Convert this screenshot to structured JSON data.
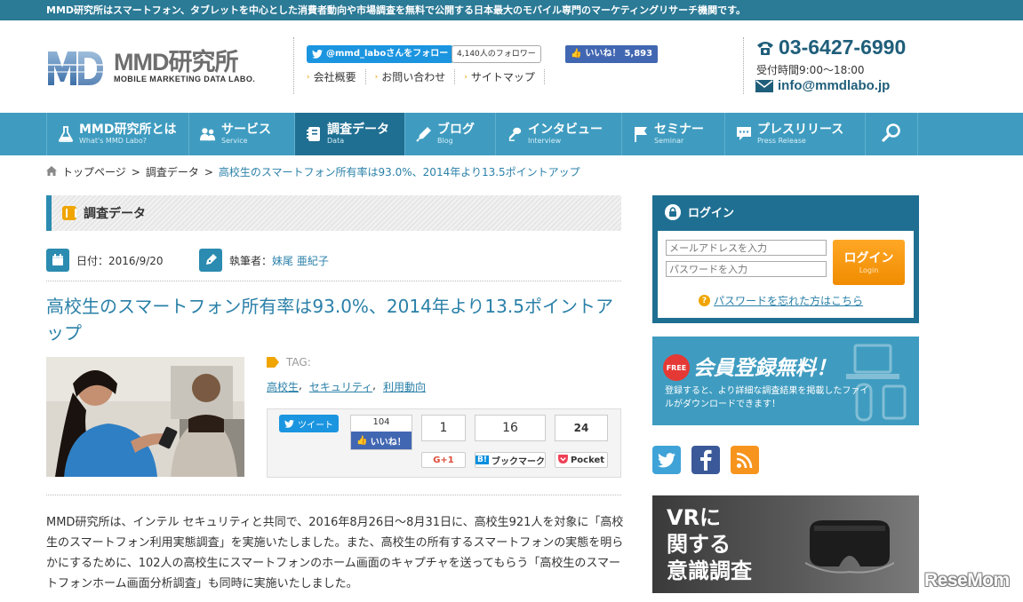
{
  "topbar": {
    "text": "MMD研究所はスマートフォン、タブレットを中心とした消費者動向や市場調査を無料で公開する日本最大のモバイル専門のマーケティングリサーチ機関です。"
  },
  "logo": {
    "title": "MMD研究所",
    "subtitle": "MOBILE MARKETING DATA LABO."
  },
  "social_header": {
    "twitter_follow": "@mmd_laboさんをフォロー",
    "follower_count": "4,140人のフォロワー",
    "fb_like": "いいね！",
    "fb_count": "5,893"
  },
  "header_links": [
    "会社概要",
    "お問い合わせ",
    "サイトマップ"
  ],
  "contact": {
    "phone": "03-6427-6990",
    "hours": "受付時間9:00～18:00",
    "email": "info@mmdlabo.jp"
  },
  "nav": [
    {
      "label": "MMD研究所とは",
      "en": "What's MMD Labo?",
      "icon": "flask-icon"
    },
    {
      "label": "サービス",
      "en": "Service",
      "icon": "people-icon"
    },
    {
      "label": "調査データ",
      "en": "Data",
      "icon": "notebook-icon",
      "active": true
    },
    {
      "label": "ブログ",
      "en": "Blog",
      "icon": "pen-icon"
    },
    {
      "label": "インタビュー",
      "en": "Interview",
      "icon": "microphone-icon"
    },
    {
      "label": "セミナー",
      "en": "Seminar",
      "icon": "flag-icon"
    },
    {
      "label": "プレスリリース",
      "en": "Press Release",
      "icon": "speech-bubble-icon"
    }
  ],
  "breadcrumb": {
    "home": "トップページ",
    "sep": ">",
    "section": "調査データ",
    "current": "高校生のスマートフォン所有率は93.0%、2014年より13.5ポイントアップ"
  },
  "section_title": "調査データ",
  "meta": {
    "date_label": "日付：2016/9/20",
    "author_label": "執筆者：",
    "author": "妹尾 亜紀子"
  },
  "article": {
    "title": "高校生のスマートフォン所有率は93.0%、2014年より13.5ポイントアップ",
    "tag_label": "TAG:",
    "tags": [
      "高校生",
      "セキュリティ",
      "利用動向"
    ],
    "tag_sep": ",",
    "body": "MMD研究所は、インテル セキュリティと共同で、2016年8月26日～8月31日に、高校生921人を対象に「高校生のスマートフォン利用実態調査」を実施いたしました。また、高校生の所有するスマートフォンの実態を明らかにするために、102人の高校生にスマートフォンのホーム画面のキャプチャを送ってもらう「高校生のスマートフォンホーム画面分析調査」も同時に実施いたしました。"
  },
  "share": {
    "tweet": "ツイート",
    "fb_count": "104",
    "fb_like": "いいね！",
    "gplus_count": "1",
    "gplus": "G+1",
    "hatena_count": "16",
    "hatena": "ブックマーク",
    "hatena_b": "B!",
    "pocket_count": "24",
    "pocket": "Pocket"
  },
  "login": {
    "title": "ログイン",
    "email_placeholder": "メールアドレスを入力",
    "password_placeholder": "パスワードを入力",
    "button": "ログイン",
    "button_en": "Login",
    "forgot": "パスワードを忘れた方はこちら"
  },
  "register": {
    "badge": "FREE",
    "title": "会員登録無料！",
    "text": "登録すると、より詳細な調査結果を掲載したファイルがダウンロードできます！"
  },
  "vr_banner": {
    "lines": [
      "VRに",
      "関する",
      "意識調査"
    ]
  },
  "watermark": "ReseMom",
  "colors": {
    "primary": "#3f9cc0",
    "dark": "#1f6f92",
    "accent": "#f0a500",
    "link": "#2a80a8"
  }
}
